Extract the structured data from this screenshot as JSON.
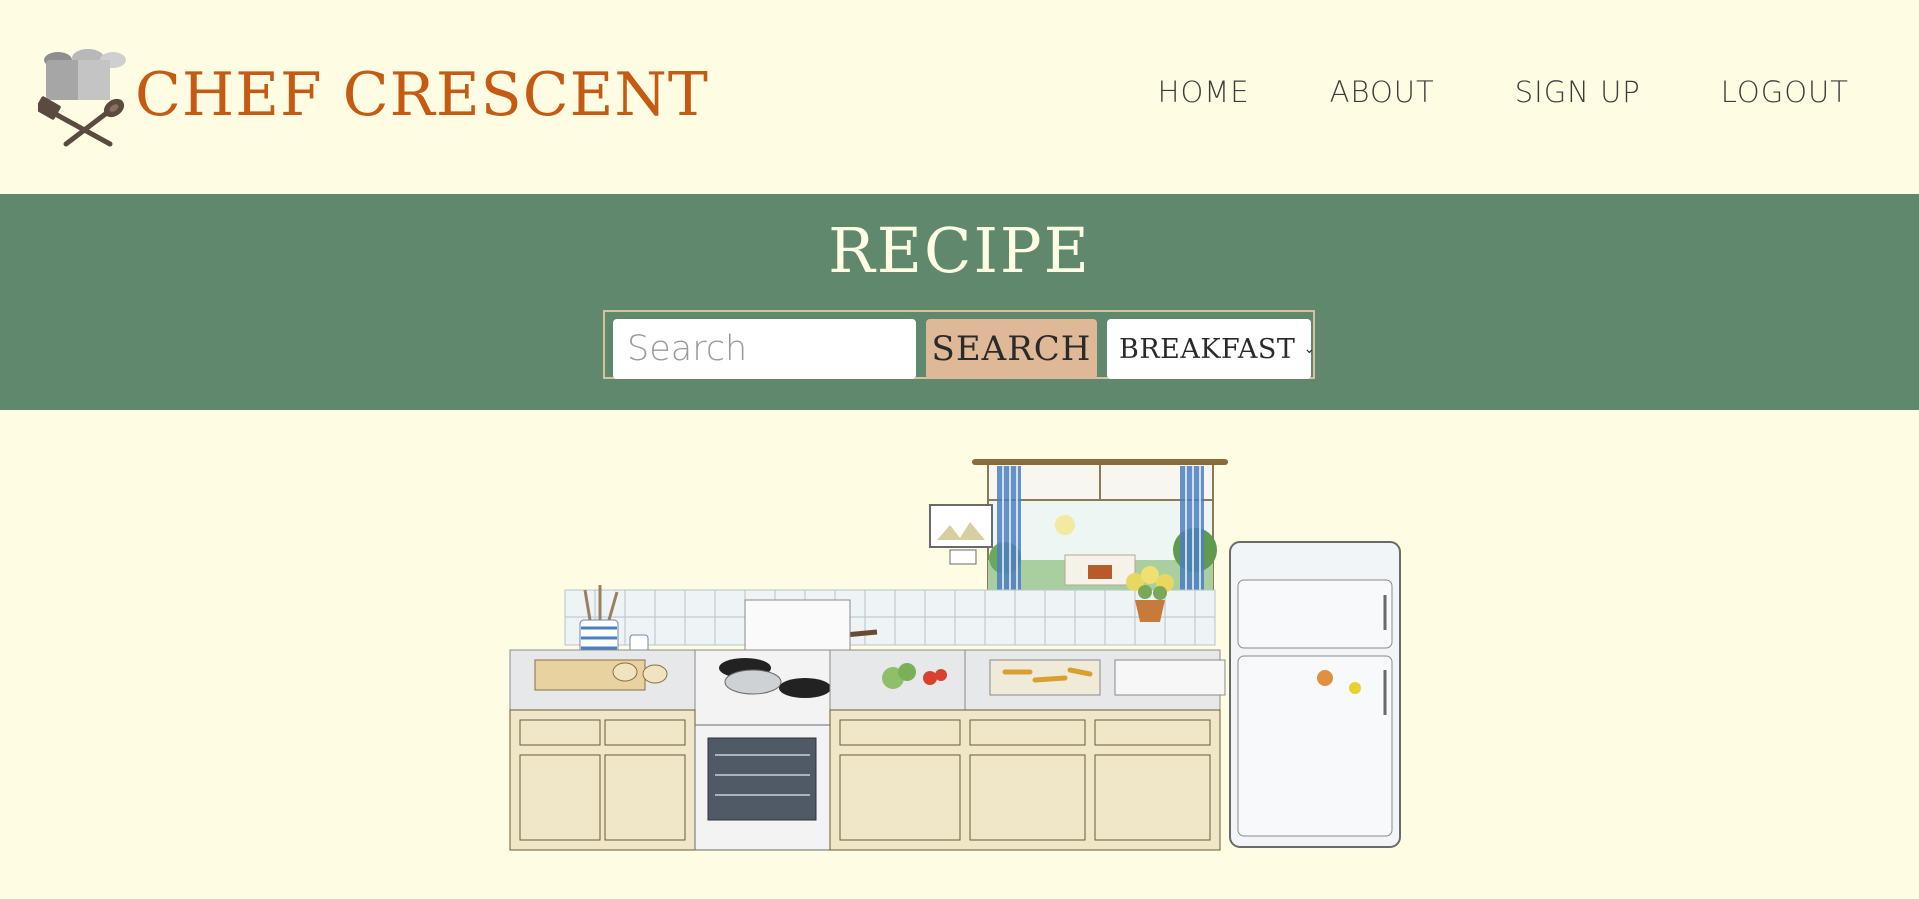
{
  "header": {
    "brand": "CHEF CRESCENT",
    "logo_icon": "chef-hat-utensils-icon",
    "nav": {
      "home": "HOME",
      "about": "ABOUT",
      "signup": "SIGN UP",
      "logout": "LOGOUT"
    }
  },
  "band": {
    "title": "RECIPE",
    "search": {
      "placeholder": "Search",
      "value": "",
      "button_label": "SEARCH",
      "category_selected": "BREAKFAST",
      "category_icon": "chevron-down-icon"
    }
  },
  "hero": {
    "illustration": "kitchen-illustration"
  },
  "colors": {
    "background": "#fefde4",
    "brand": "#c55a12",
    "band": "#5f886d",
    "button": "#dfb897",
    "border": "#d6c39e"
  }
}
